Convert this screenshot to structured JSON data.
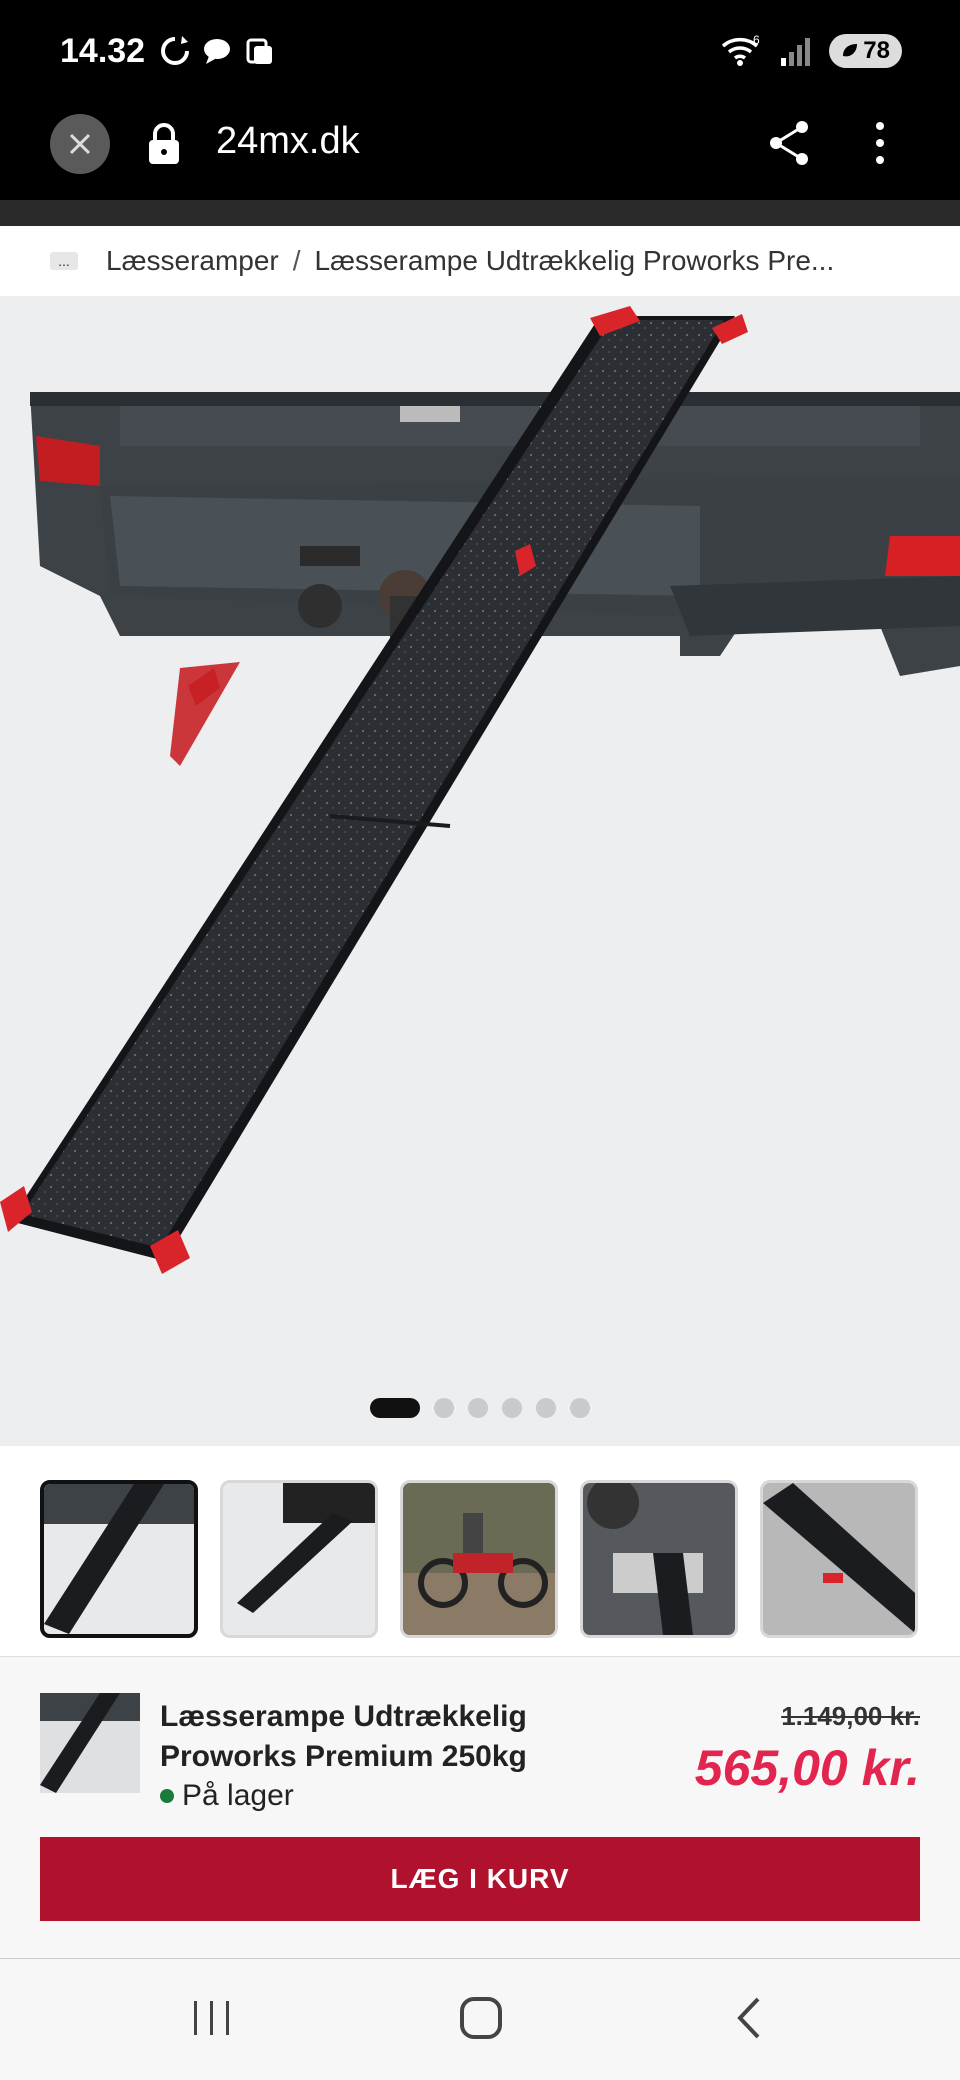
{
  "status": {
    "time": "14.32",
    "battery": "78",
    "wifi_label": "6"
  },
  "browser": {
    "url": "24mx.dk"
  },
  "breadcrumb": {
    "more": "...",
    "items": [
      "Læsseramper",
      "Læsserampe Udtrækkelig Proworks Pre..."
    ],
    "separator": "/"
  },
  "carousel": {
    "slide_count": 6,
    "active_index": 0
  },
  "product": {
    "title": "Læsserampe Udtrækkelig Proworks Premium 250kg",
    "stock": "På lager",
    "old_price": "1.149,00 kr.",
    "price": "565,00 kr.",
    "add_to_cart": "LÆG I KURV"
  },
  "colors": {
    "accent": "#b0122e",
    "price": "#e2254e",
    "in_stock": "#1a7b3a"
  }
}
